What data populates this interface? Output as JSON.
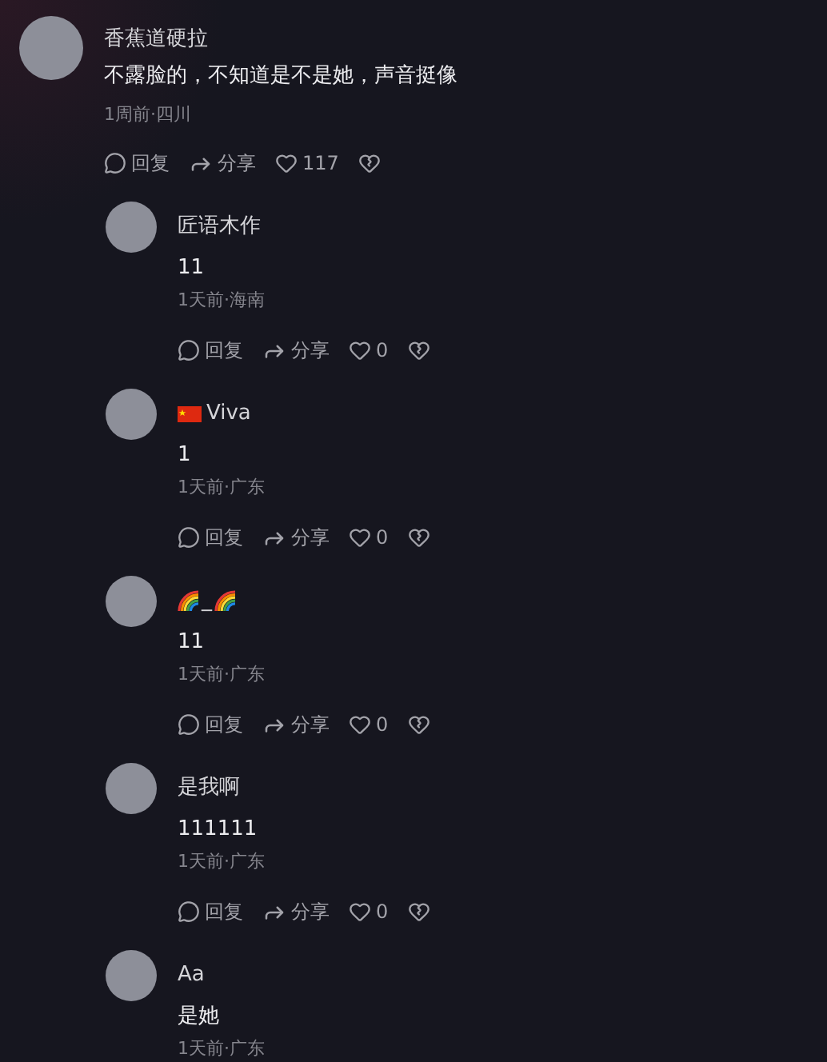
{
  "comment": {
    "author": {
      "name": "香蕉道硬拉"
    },
    "text": "不露脸的，不知道是不是她，声音挺像",
    "meta": "1周前·四川",
    "actions": {
      "reply": "回复",
      "share": "分享",
      "likes": "117"
    }
  },
  "replies": [
    {
      "author": {
        "name": "匠语木作",
        "kind": "plain"
      },
      "text": "11",
      "meta": "1天前·海南",
      "actions": {
        "reply": "回复",
        "share": "分享",
        "likes": "0"
      }
    },
    {
      "author": {
        "name": "Viva",
        "kind": "flag"
      },
      "text": "1",
      "meta": "1天前·广东",
      "actions": {
        "reply": "回复",
        "share": "分享",
        "likes": "0"
      }
    },
    {
      "author": {
        "name": "_",
        "kind": "rainbow"
      },
      "text": "11",
      "meta": "1天前·广东",
      "actions": {
        "reply": "回复",
        "share": "分享",
        "likes": "0"
      }
    },
    {
      "author": {
        "name": "是我啊",
        "kind": "plain"
      },
      "text": "111111",
      "meta": "1天前·广东",
      "actions": {
        "reply": "回复",
        "share": "分享",
        "likes": "0"
      }
    },
    {
      "author": {
        "name": "Aa",
        "kind": "plain"
      },
      "text": "是她",
      "meta": "1天前·广东"
    }
  ]
}
